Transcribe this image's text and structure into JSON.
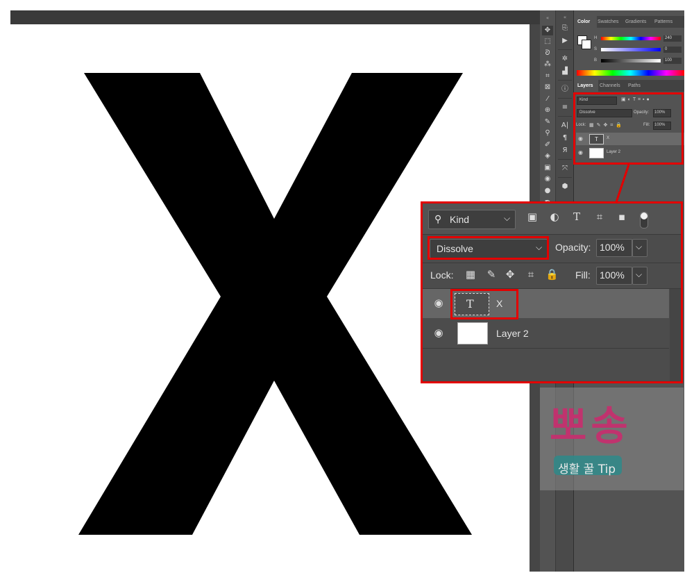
{
  "canvas": {
    "letter": "X"
  },
  "tools": {
    "items": [
      "move",
      "marquee",
      "lasso",
      "magic-wand",
      "crop",
      "frame",
      "eyedropper",
      "healing",
      "brush",
      "stamp",
      "history-brush",
      "eraser",
      "gradient",
      "blur",
      "dodge",
      "pen"
    ]
  },
  "color_panel": {
    "tabs": [
      "Color",
      "Swatches",
      "Gradients",
      "Patterns"
    ],
    "active_tab": "Color",
    "rows": [
      {
        "label": "H",
        "value": "240"
      },
      {
        "label": "S",
        "value": "0"
      },
      {
        "label": "B",
        "value": "100"
      }
    ]
  },
  "layers_panel": {
    "tabs": [
      "Layers",
      "Channels",
      "Paths"
    ],
    "active_tab": "Layers",
    "filter": "Kind",
    "blend_mode": "Dissolve",
    "opacity_label": "Opacity:",
    "opacity_value": "100%",
    "lock_label": "Lock:",
    "fill_label": "Fill:",
    "fill_value": "100%",
    "layers": [
      {
        "name": "X",
        "type": "text",
        "thumb_glyph": "T",
        "selected": true,
        "visible": true
      },
      {
        "name": "Layer 2",
        "type": "pixel",
        "thumb_glyph": "",
        "selected": false,
        "visible": true
      }
    ]
  },
  "zoom_callout": {
    "filter": "Kind",
    "blend_mode": "Dissolve",
    "opacity_label": "Opacity:",
    "opacity_value": "100%",
    "lock_label": "Lock:",
    "fill_label": "Fill:",
    "fill_value": "100%",
    "layers": [
      {
        "name": "X",
        "thumb_glyph": "T",
        "selected": true
      },
      {
        "name": "Layer 2",
        "thumb_glyph": "",
        "selected": false
      }
    ]
  },
  "watermark": {
    "title": "뽀송",
    "subtitle": "생활 꿀 Tip"
  },
  "colors": {
    "highlight_red": "#e30000",
    "panel_bg": "#535353",
    "watermark_pink": "#c0336e",
    "watermark_teal": "#2e8a8a"
  }
}
